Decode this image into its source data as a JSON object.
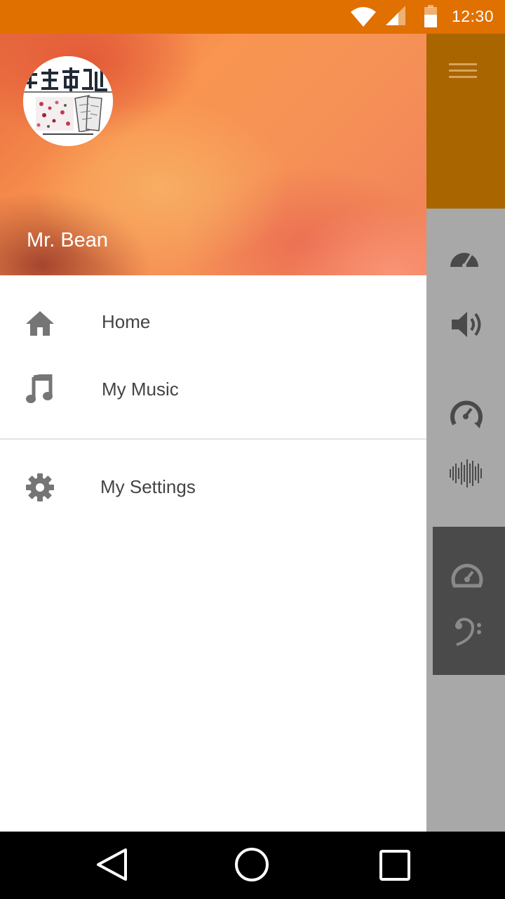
{
  "status_bar": {
    "time": "12:30",
    "icons": [
      "wifi-icon",
      "cell-signal-icon",
      "battery-icon"
    ],
    "background": "#e07000"
  },
  "drawer": {
    "header": {
      "user_name": "Mr. Bean",
      "avatar": "design-studio-logo-avatar"
    },
    "menu": [
      {
        "icon": "home-icon",
        "label": "Home"
      },
      {
        "icon": "music-note-icon",
        "label": "My Music"
      }
    ],
    "secondary_menu": [
      {
        "icon": "gear-icon",
        "label": "My Settings"
      }
    ]
  },
  "background_screen": {
    "toolbar_color": "#a86500",
    "icons": [
      "hamburger-menu-icon",
      "speedometer-icon",
      "volume-icon",
      "speed-arrow-icon",
      "sound-wave-icon",
      "gauge-icon",
      "bass-clef-icon"
    ]
  },
  "nav_bar": {
    "buttons": [
      "back-button",
      "home-button",
      "recents-button"
    ]
  }
}
